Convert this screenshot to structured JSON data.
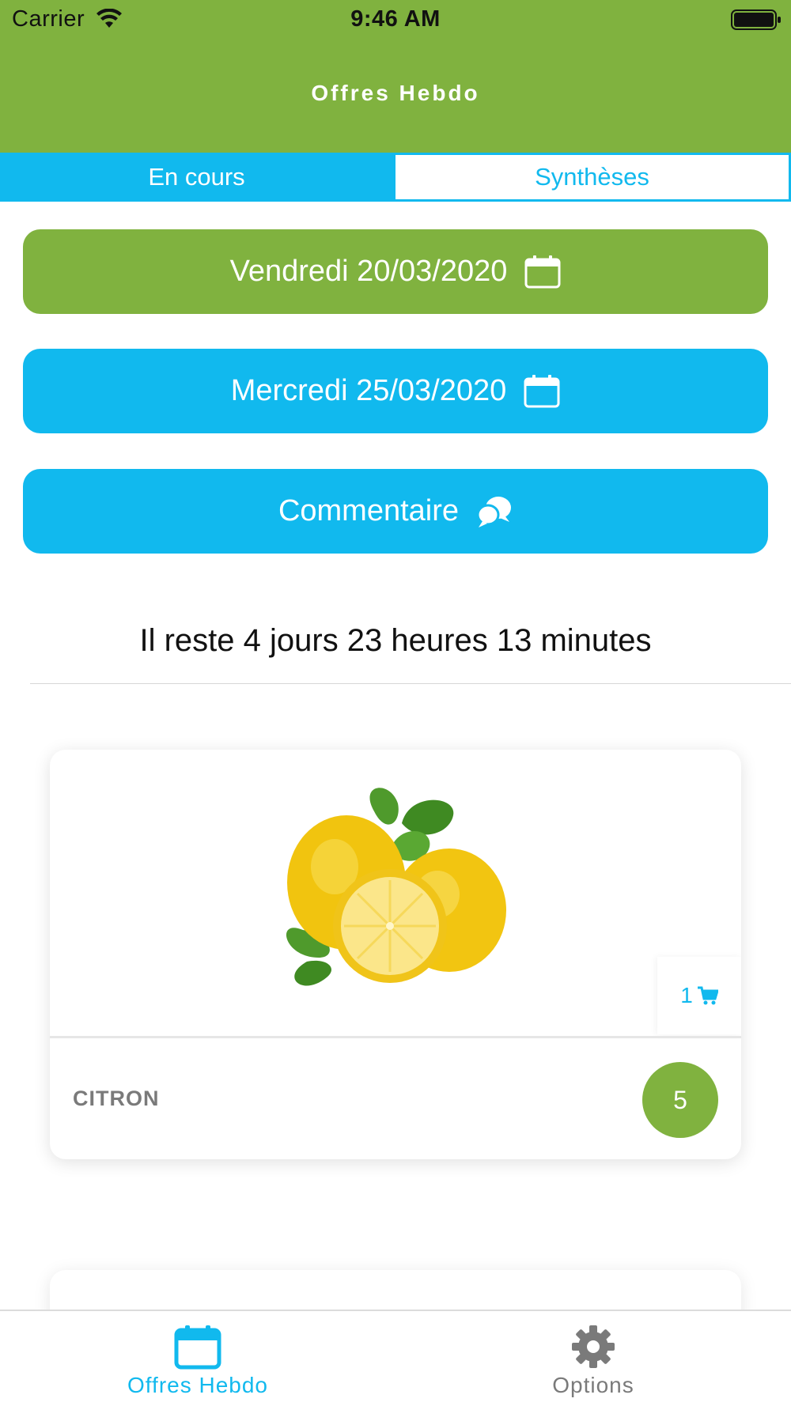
{
  "status_bar": {
    "carrier": "Carrier",
    "time": "9:46 AM",
    "icons": [
      "wifi-icon",
      "battery-icon"
    ]
  },
  "header": {
    "title": "Offres Hebdo",
    "background_color": "#80b23f"
  },
  "tabs": [
    {
      "label": "En cours",
      "selected": true
    },
    {
      "label": "Synthèses",
      "selected": false
    }
  ],
  "actions": {
    "start_date": {
      "label": "Vendredi 20/03/2020",
      "icon": "calendar-icon",
      "color": "#80b23f"
    },
    "end_date": {
      "label": "Mercredi 25/03/2020",
      "icon": "calendar-icon",
      "color": "#11b9ee"
    },
    "comment": {
      "label": "Commentaire",
      "icon": "chat-bubbles-icon",
      "color": "#11b9ee"
    }
  },
  "countdown": "Il reste 4 jours 23 heures 13 minutes",
  "products": [
    {
      "name": "CITRON",
      "image": "lemons-image",
      "cart_count": "1",
      "cart_icon": "cart-icon",
      "quantity": "5"
    }
  ],
  "tab_bar": [
    {
      "label": "Offres Hebdo",
      "icon": "calendar-icon",
      "selected": true
    },
    {
      "label": "Options",
      "icon": "gear-icon",
      "selected": false
    }
  ],
  "colors": {
    "green": "#80b23f",
    "blue": "#11b9ee"
  }
}
